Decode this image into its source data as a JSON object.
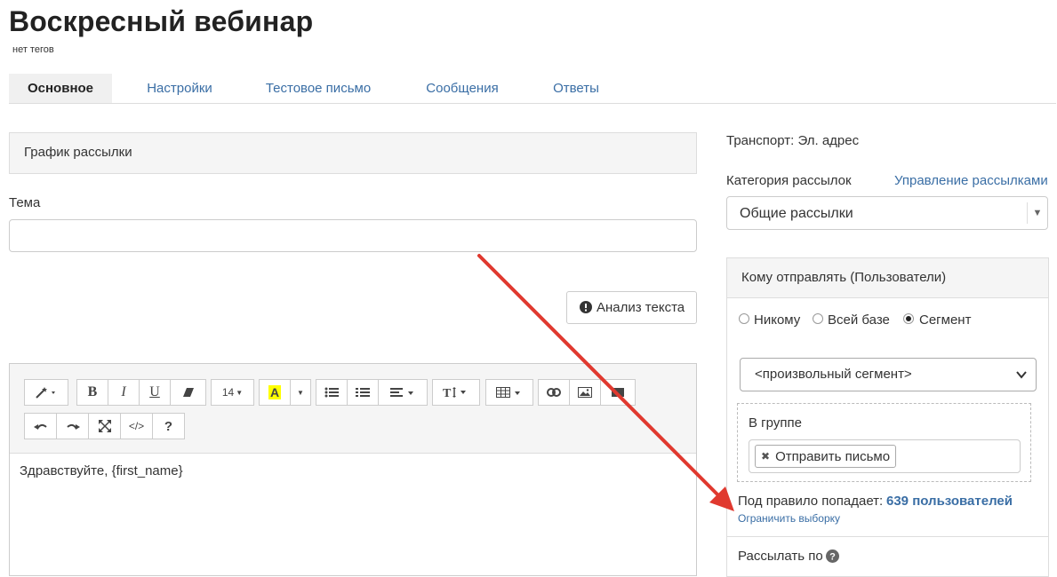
{
  "header": {
    "title": "Воскресный вебинар",
    "tags": "нет тегов"
  },
  "tabs": [
    {
      "label": "Основное",
      "active": true
    },
    {
      "label": "Настройки",
      "active": false
    },
    {
      "label": "Тестовое письмо",
      "active": false
    },
    {
      "label": "Сообщения",
      "active": false
    },
    {
      "label": "Ответы",
      "active": false
    }
  ],
  "schedule": {
    "label": "График рассылки"
  },
  "subject": {
    "label": "Тема",
    "value": "",
    "placeholder": ""
  },
  "analyze_button": {
    "label": "Анализ текста",
    "icon": "exclamation-circle-icon"
  },
  "editor": {
    "font_size": "14",
    "content": "Здравствуйте, {first_name}",
    "toolbar_icons": [
      "magic-wand-icon",
      "bold-icon",
      "italic-icon",
      "underline-icon",
      "eraser-icon",
      "font-size-select",
      "highlight-icon",
      "bullet-list-icon",
      "numbered-list-icon",
      "align-icon",
      "text-height-icon",
      "table-icon",
      "link-icon",
      "image-icon",
      "video-icon",
      "undo-icon",
      "redo-icon",
      "fullscreen-icon",
      "code-view-icon",
      "help-icon"
    ],
    "labels": {
      "bold": "B",
      "italic": "I",
      "underline": "U",
      "highlight": "A",
      "help": "?",
      "code": "</>"
    }
  },
  "sidebar": {
    "transport": "Транспорт: Эл. адрес",
    "category_label": "Категория рассылок",
    "manage_link": "Управление рассылками",
    "category_value": "Общие рассылки",
    "who": {
      "title": "Кому отправлять (Пользователи)",
      "options": [
        {
          "label": "Никому",
          "checked": false
        },
        {
          "label": "Всей базе",
          "checked": false
        },
        {
          "label": "Сегмент",
          "checked": true
        }
      ],
      "segment_value": "<произвольный сегмент>",
      "group_label": "В группе",
      "group_chip": "Отправить письмо",
      "rule_text": "Под правило попадает:",
      "rule_count": "639 пользователей",
      "limit_link": "Ограничить выборку",
      "send_by": "Рассылать по"
    }
  },
  "colors": {
    "link": "#3a6ea5",
    "annotation_arrow": "#e0392f",
    "highlight": "#ffff00"
  }
}
